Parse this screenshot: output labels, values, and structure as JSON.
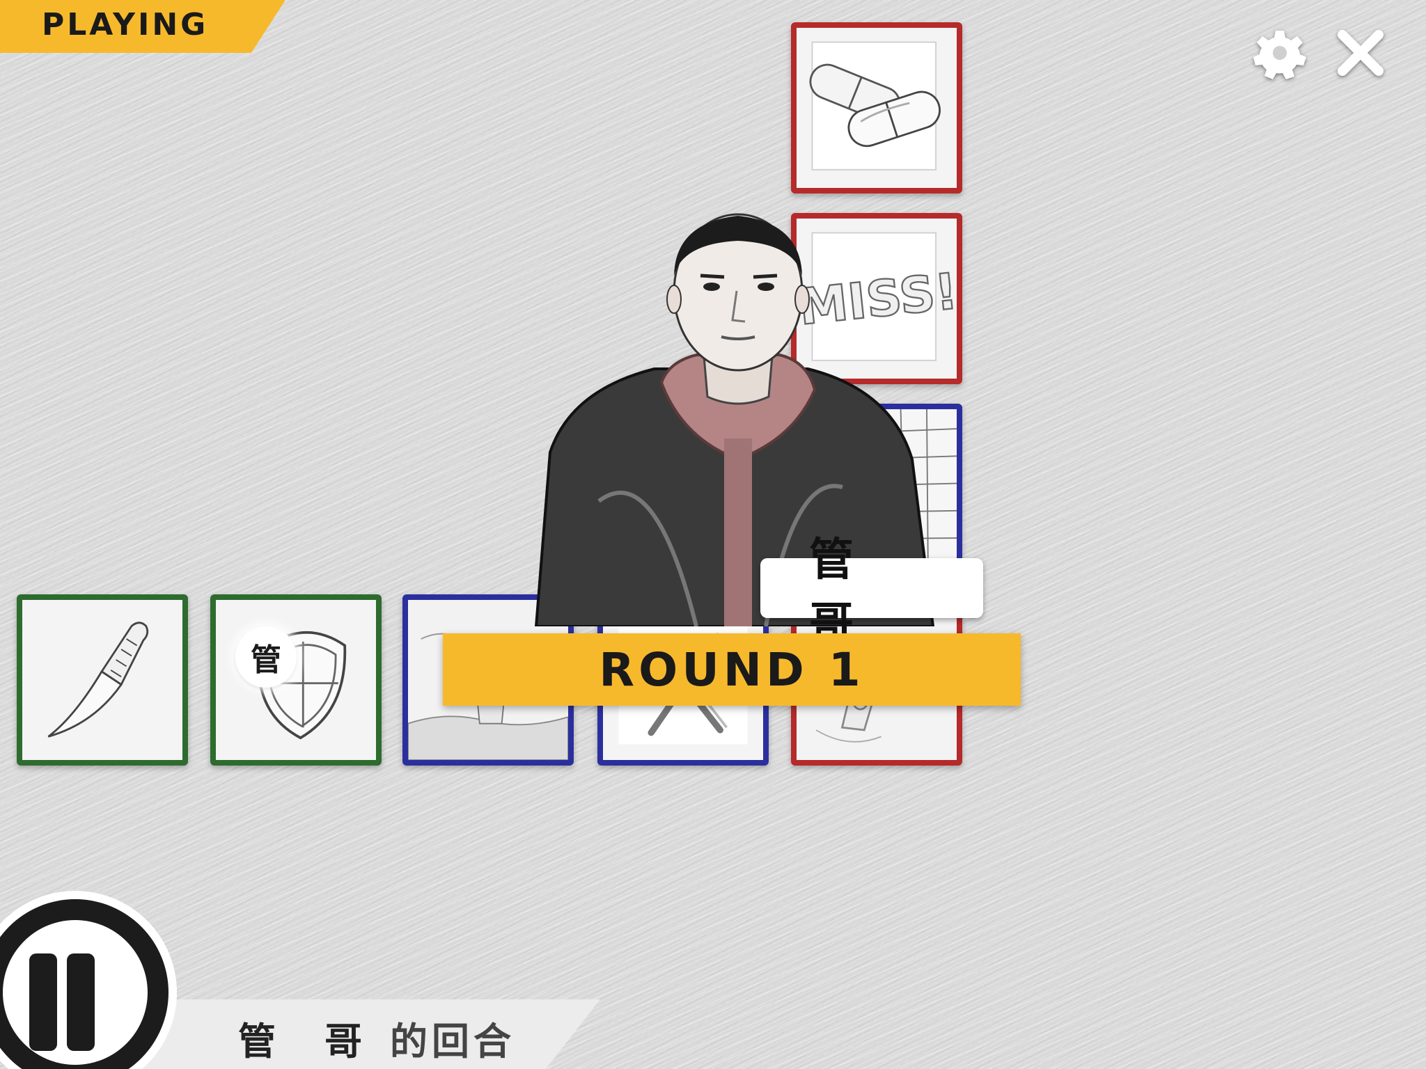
{
  "status": {
    "label": "PLAYING"
  },
  "toolbar": {
    "settings_icon": "gear-icon",
    "close_icon": "close-icon"
  },
  "cards": [
    {
      "name": "pills-card",
      "item": "pills",
      "color": "red"
    },
    {
      "name": "miss-card",
      "item": "miss",
      "color": "red",
      "text": "MISS!"
    },
    {
      "name": "fence-card",
      "item": "fence",
      "color": "blue"
    },
    {
      "name": "knife-card",
      "item": "knife",
      "color": "green"
    },
    {
      "name": "shield-card",
      "item": "shield",
      "color": "green",
      "owner_badge": "管"
    },
    {
      "name": "explosion-card",
      "item": "explosion",
      "color": "blue"
    },
    {
      "name": "x-mark-card",
      "item": "x-mark",
      "color": "blue"
    },
    {
      "name": "gun-card",
      "item": "gun",
      "color": "red"
    }
  ],
  "player": {
    "name": "管哥"
  },
  "round": {
    "label": "ROUND 1"
  },
  "turn": {
    "player_name": "管哥",
    "suffix": "的回合"
  },
  "colors": {
    "accent": "#f7b92c",
    "red": "#b52a2a",
    "blue": "#2b2f9e",
    "green": "#2e6b2e",
    "dark": "#1a1a1a"
  }
}
